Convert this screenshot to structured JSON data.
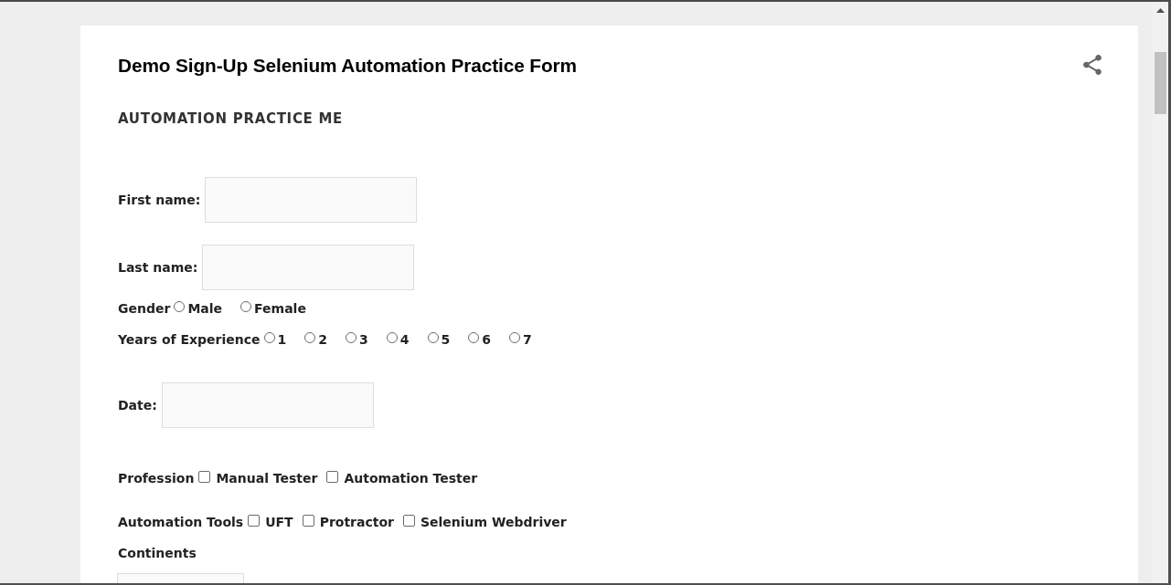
{
  "page": {
    "title": "Demo Sign-Up Selenium Automation Practice Form",
    "subheading": "AUTOMATION PRACTICE ME"
  },
  "fields": [
    {
      "kind": "text",
      "label": "First name:"
    },
    {
      "kind": "text",
      "label": "Last name:"
    },
    {
      "kind": "radio",
      "label": "Gender",
      "options": [
        {
          "label": "Male",
          "selected": false
        },
        {
          "label": "Female",
          "selected": false
        }
      ]
    },
    {
      "kind": "radio",
      "label": "Years of Experience",
      "options": [
        {
          "label": "1",
          "selected": false
        },
        {
          "label": "2",
          "selected": false
        },
        {
          "label": "3",
          "selected": false
        },
        {
          "label": "4",
          "selected": false
        },
        {
          "label": "5",
          "selected": false
        },
        {
          "label": "6",
          "selected": false
        },
        {
          "label": "7",
          "selected": false
        }
      ]
    },
    {
      "kind": "text",
      "label": "Date:"
    },
    {
      "kind": "checkbox",
      "label": "Profession",
      "options": [
        {
          "label": "Manual Tester",
          "checked": false
        },
        {
          "label": "Automation Tester",
          "checked": false
        }
      ]
    },
    {
      "kind": "checkbox",
      "label": "Automation Tools",
      "options": [
        {
          "label": "UFT",
          "checked": false
        },
        {
          "label": "Protractor",
          "checked": false
        },
        {
          "label": "Selenium Webdriver",
          "checked": false
        }
      ]
    },
    {
      "kind": "select",
      "label": "Continents"
    }
  ]
}
